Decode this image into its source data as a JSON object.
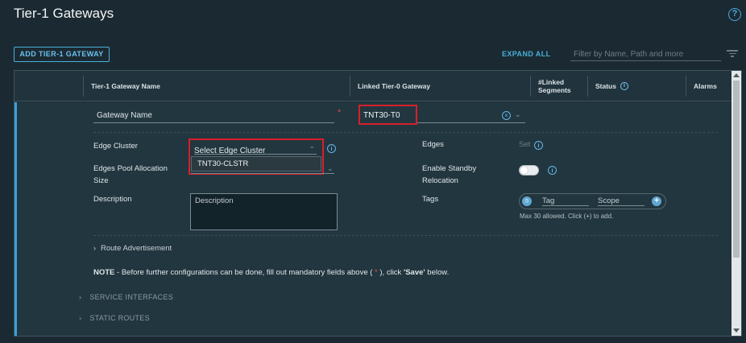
{
  "page": {
    "title": "Tier-1 Gateways"
  },
  "toolbar": {
    "add_label": "ADD TIER-1 GATEWAY",
    "expand_all_label": "EXPAND ALL",
    "filter_placeholder": "Filter by Name, Path and more"
  },
  "table": {
    "columns": [
      "Tier-1 Gateway Name",
      "Linked Tier-0 Gateway",
      "#Linked Segments",
      "Status",
      "Alarms"
    ]
  },
  "form": {
    "gateway_name_value": "Gateway Name",
    "required_mark": "*",
    "linked_tier0_value": "TNT30-T0",
    "edge_cluster_label": "Edge Cluster",
    "edge_cluster_placeholder": "Select Edge Cluster",
    "edge_cluster_option": "TNT30-CLSTR",
    "edge_pool_label_1": "Edges Pool Allocation",
    "edge_pool_label_2": "Size",
    "description_label": "Description",
    "description_placeholder": "Description",
    "edges_label": "Edges",
    "edges_set": "Set",
    "standby_label_1": "Enable Standby",
    "standby_label_2": "Relocation",
    "tags_label": "Tags",
    "tag_placeholder": "Tag",
    "scope_placeholder": "Scope",
    "tags_hint": "Max 30 allowed. Click (+) to add.",
    "route_adv_label": "Route Advertisement",
    "note_prefix": "NOTE",
    "note_text": " - Before further configurations can be done, fill out mandatory fields above ( ",
    "note_star": "*",
    "note_text2": " ), click ",
    "note_save": "'Save'",
    "note_text3": " below.",
    "service_interfaces_label": "SERVICE INTERFACES",
    "static_routes_label": "STATIC ROUTES"
  },
  "colors": {
    "accent": "#49afd9",
    "highlight": "#d6202a",
    "background": "#1b2a32"
  }
}
